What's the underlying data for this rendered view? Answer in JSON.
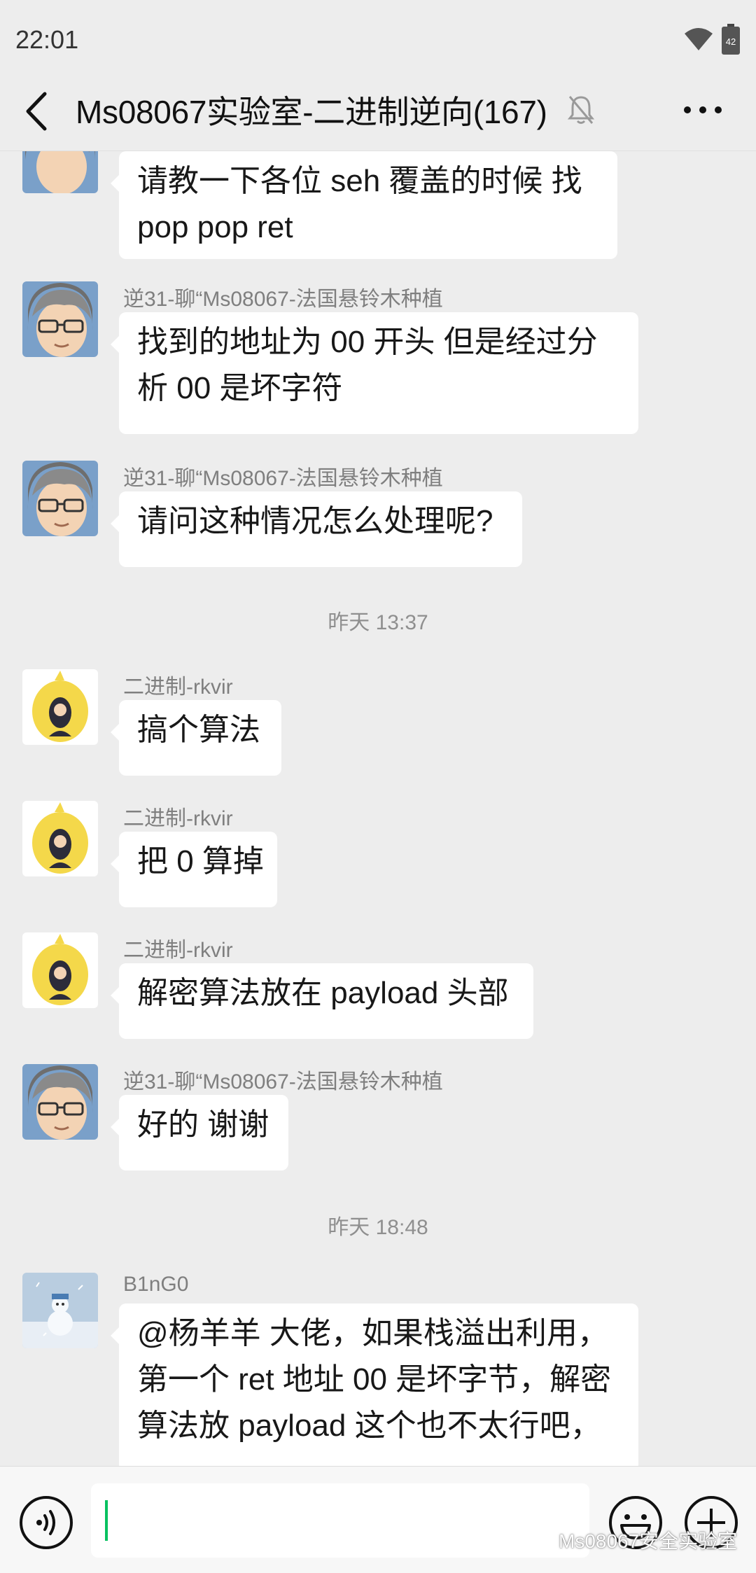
{
  "status_bar": {
    "time": "22:01",
    "battery": "42"
  },
  "header": {
    "title": "Ms08067实验室-二进制逆向(167)"
  },
  "messages": [
    {
      "sender": "",
      "avatar": "anime-glasses-avatar",
      "lines": [
        "请教一下各位 seh 覆盖的时候 找",
        "pop pop ret"
      ]
    },
    {
      "sender": "逆31-聊“Ms08067-法国悬铃木种植",
      "avatar": "anime-glasses-avatar",
      "lines": [
        "找到的地址为 00 开头 但是经过分",
        "析 00 是坏字符"
      ]
    },
    {
      "sender": "逆31-聊“Ms08067-法国悬铃木种植",
      "avatar": "anime-glasses-avatar",
      "lines": [
        "请问这种情况怎么处理呢?"
      ]
    },
    {
      "timestamp": "昨天 13:37"
    },
    {
      "sender": "二进制-rkvir",
      "avatar": "yellow-chick-avatar",
      "lines": [
        "搞个算法"
      ]
    },
    {
      "sender": "二进制-rkvir",
      "avatar": "yellow-chick-avatar",
      "lines": [
        "把 0 算掉"
      ]
    },
    {
      "sender": "二进制-rkvir",
      "avatar": "yellow-chick-avatar",
      "lines": [
        "解密算法放在 payload 头部"
      ]
    },
    {
      "sender": "逆31-聊“Ms08067-法国悬铃木种植",
      "avatar": "anime-glasses-avatar",
      "lines": [
        "好的 谢谢"
      ]
    },
    {
      "timestamp": "昨天 18:48"
    },
    {
      "sender": "B1nG0",
      "avatar": "snowman-avatar",
      "lines": [
        "@杨羊羊  大佬，如果栈溢出利用，",
        "第一个 ret 地址 00 是坏字节，解密",
        "算法放 payload 这个也不太行吧，"
      ]
    }
  ],
  "input": {
    "value": ""
  },
  "watermark": {
    "text": "Ms08067安全实验室"
  },
  "colors": {
    "background": "#ededed",
    "bubble": "#ffffff",
    "accent": "#07c160"
  }
}
